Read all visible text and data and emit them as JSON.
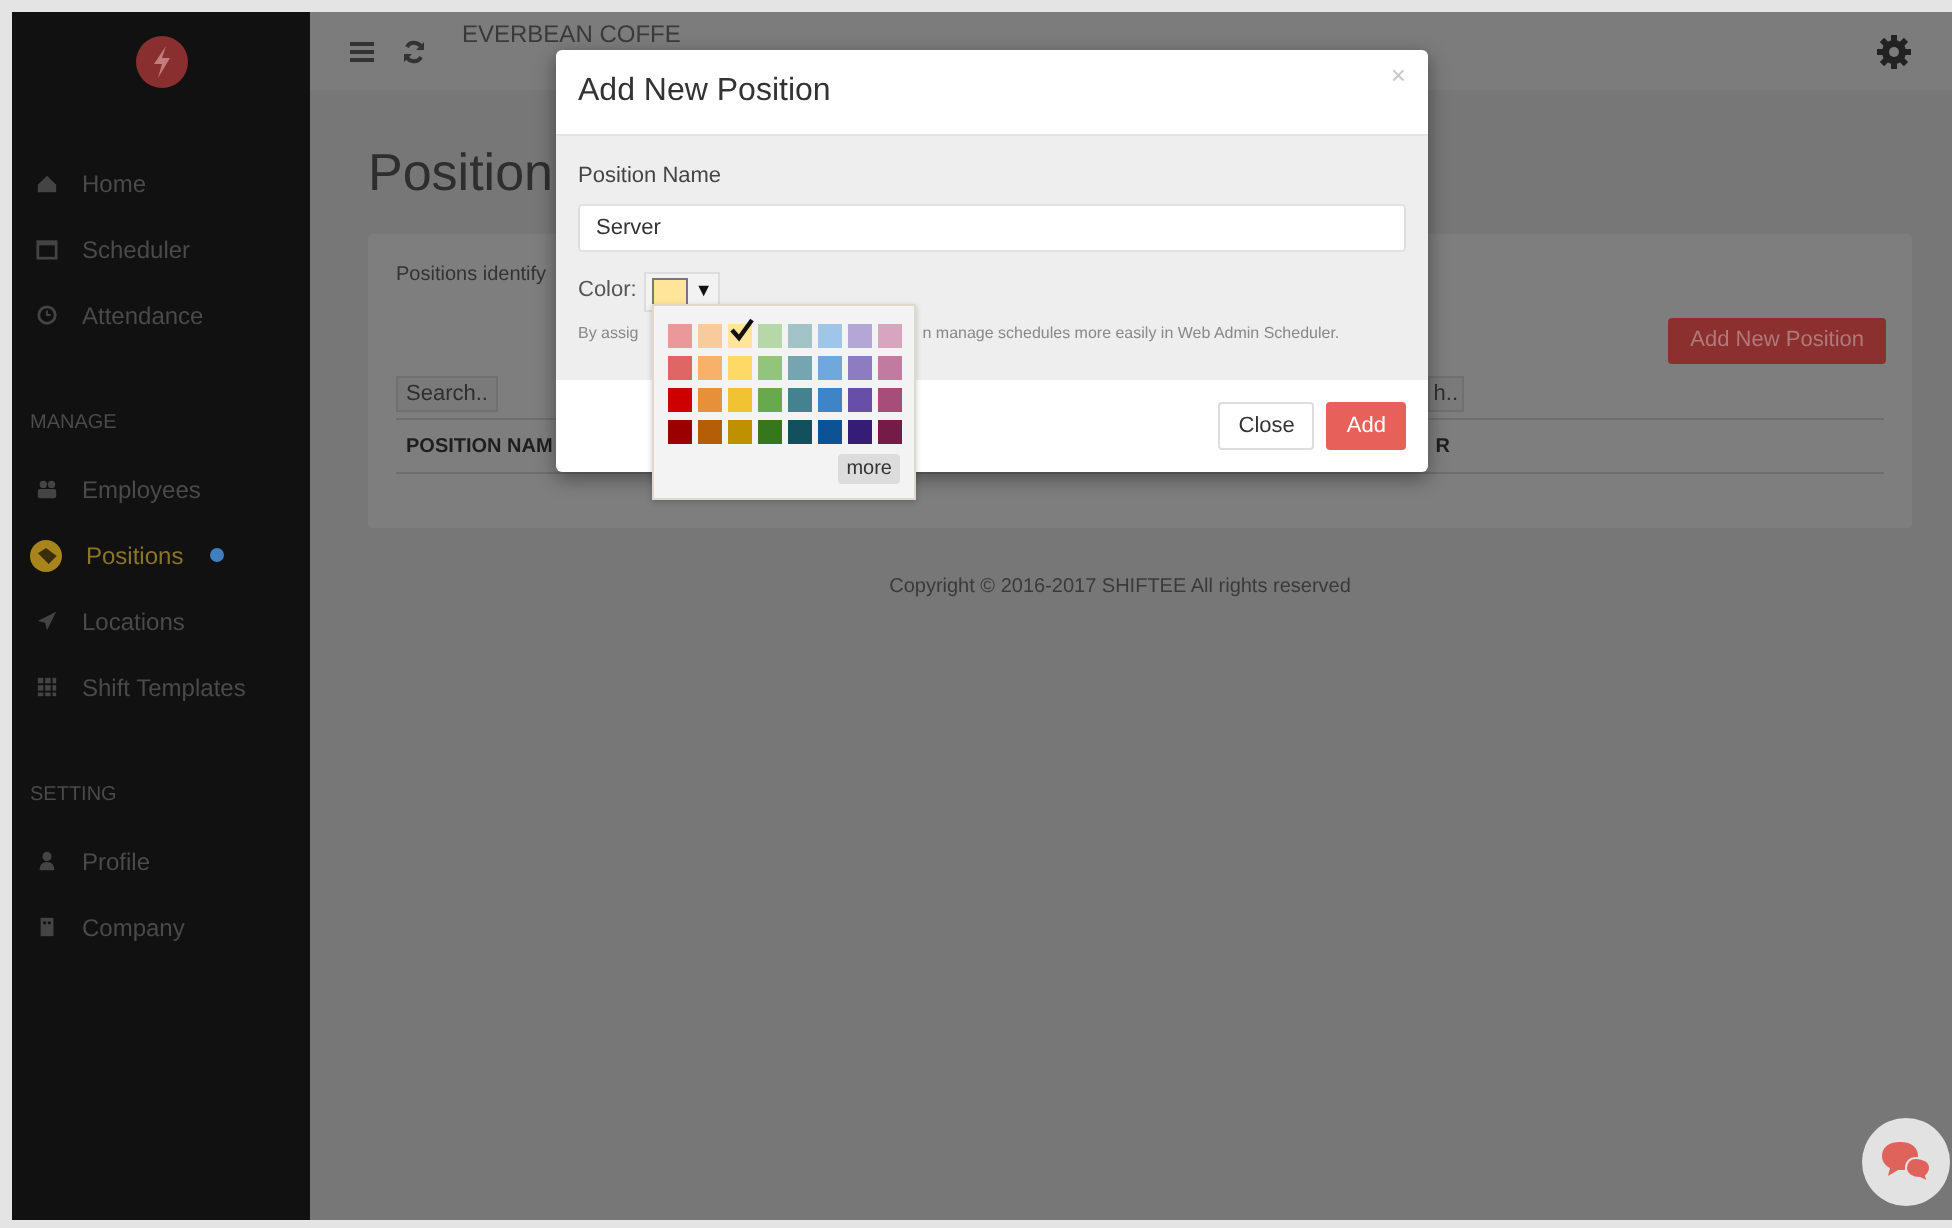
{
  "sidebar": {
    "groups": [
      {
        "items": [
          {
            "label": "Home",
            "selected": false,
            "notification": false
          },
          {
            "label": "Scheduler",
            "selected": false,
            "notification": false
          },
          {
            "label": "Attendance",
            "selected": false,
            "notification": false
          }
        ]
      },
      {
        "heading": "MANAGE",
        "items": [
          {
            "label": "Employees",
            "selected": false,
            "notification": false
          },
          {
            "label": "Positions",
            "selected": true,
            "notification": true
          },
          {
            "label": "Locations",
            "selected": false,
            "notification": false
          },
          {
            "label": "Shift Templates",
            "selected": false,
            "notification": false
          }
        ]
      },
      {
        "heading": "SETTING",
        "items": [
          {
            "label": "Profile",
            "selected": false,
            "notification": false
          },
          {
            "label": "Company",
            "selected": false,
            "notification": false
          }
        ]
      }
    ]
  },
  "top_bar": {
    "title": "EVERBEAN COFFE"
  },
  "page": {
    "heading": "Position",
    "description": "Positions identify",
    "add_button": "Add New Position",
    "search_fields": [
      {
        "placeholder": "Search.."
      },
      {
        "placeholder": "h.."
      }
    ],
    "columns": [
      "POSITION NAM",
      "R"
    ]
  },
  "footer": "Copyright © 2016-2017 SHIFTEE All rights reserved",
  "dialog": {
    "title": "Add New Position",
    "close": "×",
    "field_label": "Position Name",
    "field_value": "Server",
    "color_label": "Color:",
    "dropdown_arrow": "▼",
    "help_start": "By assig",
    "help_end": "n manage schedules more easily in Web Admin Scheduler.",
    "palette": {
      "swatches": [
        {
          "color": "#ea9999",
          "selected": false
        },
        {
          "color": "#f9cb9c",
          "selected": false
        },
        {
          "color": "#ffe599",
          "selected": true
        },
        {
          "color": "#b6d7a8",
          "selected": false
        },
        {
          "color": "#a2c4c9",
          "selected": false
        },
        {
          "color": "#9fc5e8",
          "selected": false
        },
        {
          "color": "#b4a7d6",
          "selected": false
        },
        {
          "color": "#d5a6bd",
          "selected": false
        },
        {
          "color": "#e06666",
          "selected": false
        },
        {
          "color": "#f6b26b",
          "selected": false
        },
        {
          "color": "#ffd966",
          "selected": false
        },
        {
          "color": "#93c47d",
          "selected": false
        },
        {
          "color": "#76a5af",
          "selected": false
        },
        {
          "color": "#6fa8dc",
          "selected": false
        },
        {
          "color": "#8e7cc3",
          "selected": false
        },
        {
          "color": "#c27ba0",
          "selected": false
        },
        {
          "color": "#cc0000",
          "selected": false
        },
        {
          "color": "#e69138",
          "selected": false
        },
        {
          "color": "#f1c232",
          "selected": false
        },
        {
          "color": "#6aa84f",
          "selected": false
        },
        {
          "color": "#45818e",
          "selected": false
        },
        {
          "color": "#3d85c6",
          "selected": false
        },
        {
          "color": "#674ea7",
          "selected": false
        },
        {
          "color": "#a64d79",
          "selected": false
        },
        {
          "color": "#990000",
          "selected": false
        },
        {
          "color": "#b45f06",
          "selected": false
        },
        {
          "color": "#bf9000",
          "selected": false
        },
        {
          "color": "#38761d",
          "selected": false
        },
        {
          "color": "#134f5c",
          "selected": false
        },
        {
          "color": "#0b5394",
          "selected": false
        },
        {
          "color": "#351c75",
          "selected": false
        },
        {
          "color": "#741b47",
          "selected": false
        }
      ],
      "more": "more"
    },
    "buttons": [
      {
        "label": "Close",
        "kind": "secondary"
      },
      {
        "label": "Add",
        "kind": "primary"
      }
    ]
  }
}
